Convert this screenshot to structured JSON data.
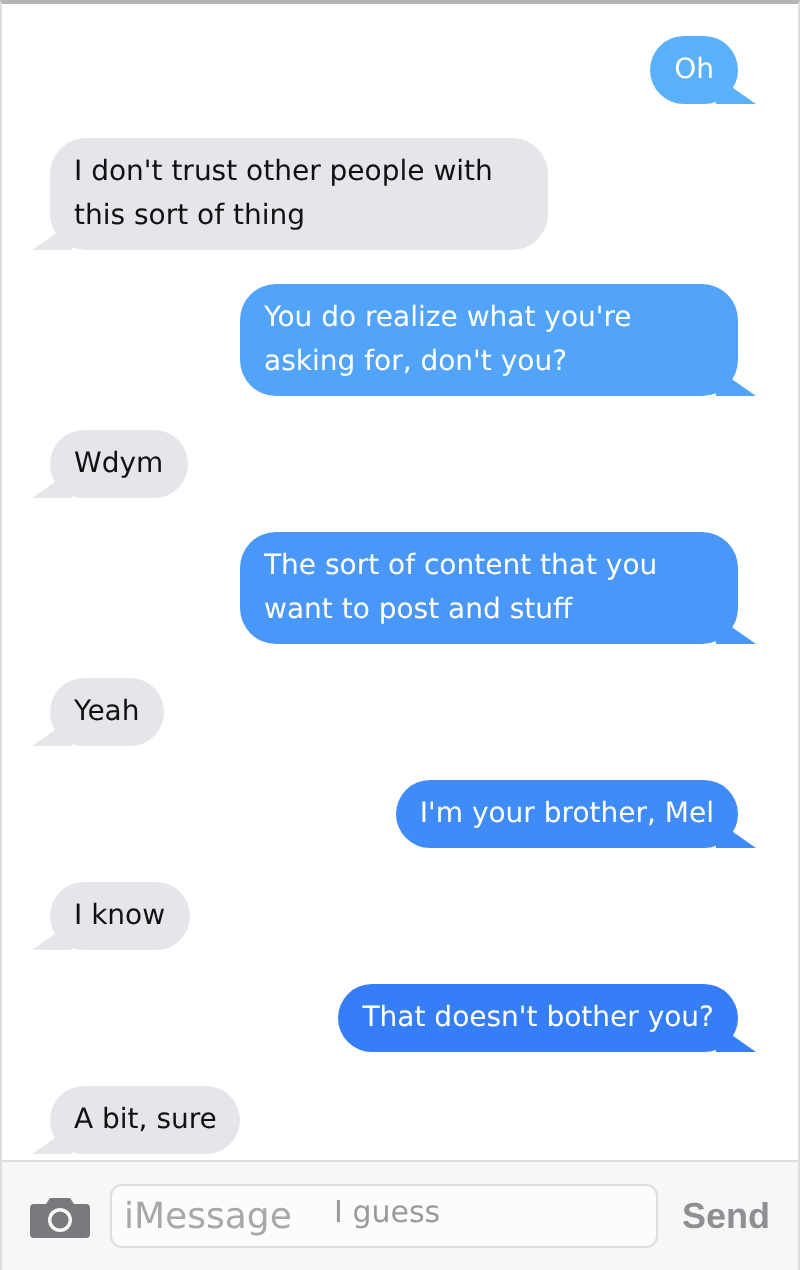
{
  "messages": [
    {
      "text": "Oh",
      "kind": "sent"
    },
    {
      "text": "I don't trust other people with this sort of thing",
      "kind": "received"
    },
    {
      "text": "You do realize what you're asking for, don't you?",
      "kind": "sent"
    },
    {
      "text": "Wdym",
      "kind": "received"
    },
    {
      "text": "The sort of content that you want to post and stuff",
      "kind": "sent"
    },
    {
      "text": "Yeah",
      "kind": "received"
    },
    {
      "text": "I'm your brother, Mel",
      "kind": "sent"
    },
    {
      "text": "I know",
      "kind": "received"
    },
    {
      "text": "That doesn't bother you?",
      "kind": "sent"
    },
    {
      "text": "A bit, sure",
      "kind": "received"
    }
  ],
  "obscured_message": "I guess",
  "compose": {
    "placeholder": "iMessage",
    "send": "Send"
  }
}
